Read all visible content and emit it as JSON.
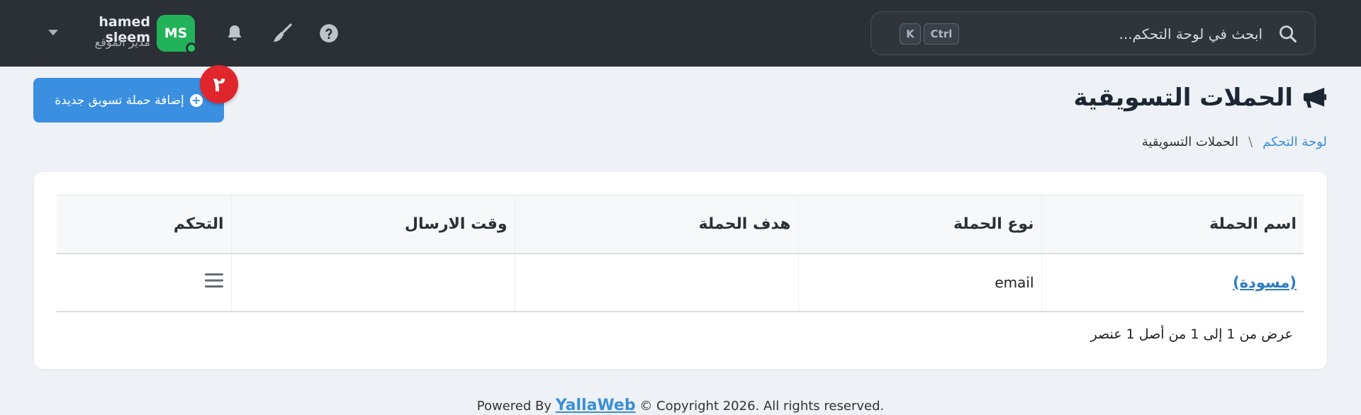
{
  "search": {
    "placeholder": "ابحث في لوحة التحكم...",
    "shortcut_ctrl": "Ctrl",
    "shortcut_k": "K"
  },
  "user": {
    "initials": "MS",
    "name": "hamed sleem",
    "role": "مدير الموقع"
  },
  "page": {
    "title": "الحملات التسويقية",
    "breadcrumb": {
      "home": "لوحة التحكم",
      "separator": "\\",
      "current": "الحملات التسويقية"
    },
    "add_button": "إضافة حملة تسويق جديدة",
    "badge": "٢"
  },
  "table": {
    "columns": [
      "اسم الحملة",
      "نوع الحملة",
      "هدف الحملة",
      "وقت الارسال",
      "التحكم"
    ],
    "rows": [
      {
        "name": "(مسودة)",
        "type": "email",
        "goal": "",
        "send_time": ""
      }
    ],
    "info": "عرض من 1 إلى 1 من أصل 1 عنصر"
  },
  "footer": {
    "prefix": "Powered By ",
    "brand": "YallaWeb",
    "suffix": " © Copyright 2026. All rights reserved."
  },
  "colors": {
    "topbar": "#2b3036",
    "primary": "#3b8fe0",
    "badge": "#e0262d",
    "avatar": "#22b35a",
    "link": "#3b8fd6"
  }
}
